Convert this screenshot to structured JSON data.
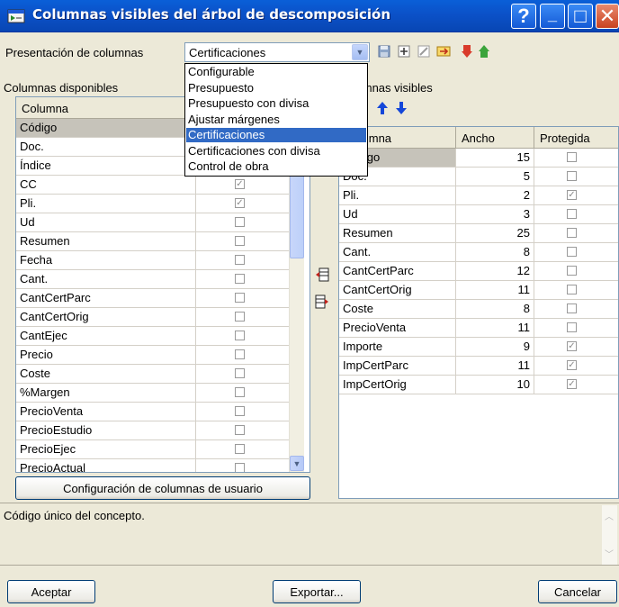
{
  "window": {
    "title": "Columnas visibles del árbol de descomposición",
    "help_btn": "?",
    "minimize_btn": "_",
    "maximize_btn": "□",
    "close_btn": "✕"
  },
  "presentation": {
    "label": "Presentación de columnas",
    "selected": "Certificaciones",
    "options": [
      "Configurable",
      "Presupuesto",
      "Presupuesto con divisa",
      "Ajustar márgenes",
      "Certificaciones",
      "Certificaciones con divisa",
      "Control de obra"
    ],
    "selected_index": 4
  },
  "toolbar": {
    "icons": [
      "save-icon",
      "add-icon",
      "delete-icon",
      "rename-icon",
      "import-icon",
      "export-icon"
    ]
  },
  "available": {
    "label": "Columnas disponibles",
    "header_column": "Columna",
    "rows": [
      {
        "name": "Código",
        "checked": false,
        "selected": true
      },
      {
        "name": "Doc.",
        "checked": false
      },
      {
        "name": "Índice",
        "checked": false
      },
      {
        "name": "CC",
        "checked": true
      },
      {
        "name": "Pli.",
        "checked": true
      },
      {
        "name": "Ud",
        "checked": false
      },
      {
        "name": "Resumen",
        "checked": false
      },
      {
        "name": "Fecha",
        "checked": false
      },
      {
        "name": "Cant.",
        "checked": false
      },
      {
        "name": "CantCertParc",
        "checked": false
      },
      {
        "name": "CantCertOrig",
        "checked": false
      },
      {
        "name": "CantEjec",
        "checked": false
      },
      {
        "name": "Precio",
        "checked": false
      },
      {
        "name": "Coste",
        "checked": false
      },
      {
        "name": "%Margen",
        "checked": false
      },
      {
        "name": "PrecioVenta",
        "checked": false
      },
      {
        "name": "PrecioEstudio",
        "checked": false
      },
      {
        "name": "PrecioEjec",
        "checked": false
      },
      {
        "name": "PrecioActual",
        "checked": false
      }
    ],
    "user_config_button": "Configuración de columnas de usuario"
  },
  "visible": {
    "label": "Columnas visibles",
    "headers": {
      "column": "Columna",
      "width": "Ancho",
      "protected": "Protegida"
    },
    "rows": [
      {
        "name": "Código",
        "width": "15",
        "protected": false
      },
      {
        "name": "Doc.",
        "width": "5",
        "protected": false
      },
      {
        "name": "Pli.",
        "width": "2",
        "protected": true
      },
      {
        "name": "Ud",
        "width": "3",
        "protected": false
      },
      {
        "name": "Resumen",
        "width": "25",
        "protected": false
      },
      {
        "name": "Cant.",
        "width": "8",
        "protected": false
      },
      {
        "name": "CantCertParc",
        "width": "12",
        "protected": false
      },
      {
        "name": "CantCertOrig",
        "width": "11",
        "protected": false
      },
      {
        "name": "Coste",
        "width": "8",
        "protected": false
      },
      {
        "name": "PrecioVenta",
        "width": "11",
        "protected": false
      },
      {
        "name": "Importe",
        "width": "9",
        "protected": true
      },
      {
        "name": "ImpCertParc",
        "width": "11",
        "protected": true
      },
      {
        "name": "ImpCertOrig",
        "width": "10",
        "protected": true
      }
    ]
  },
  "description": "Código único del concepto.",
  "buttons": {
    "accept": "Aceptar",
    "export": "Exportar...",
    "cancel": "Cancelar"
  }
}
